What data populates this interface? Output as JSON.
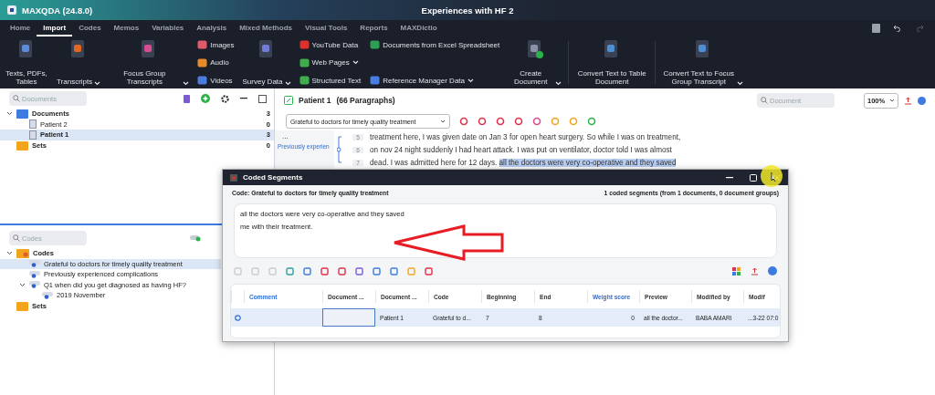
{
  "window": {
    "app_title": "MAXQDA (24.8.0)",
    "project_title": "Experiences with HF 2"
  },
  "tabs": [
    {
      "label": "Home",
      "selected": false
    },
    {
      "label": "Import",
      "selected": true
    },
    {
      "label": "Codes",
      "selected": false
    },
    {
      "label": "Memos",
      "selected": false
    },
    {
      "label": "Variables",
      "selected": false
    },
    {
      "label": "Analysis",
      "selected": false
    },
    {
      "label": "Mixed Methods",
      "selected": false
    },
    {
      "label": "Visual Tools",
      "selected": false
    },
    {
      "label": "Reports",
      "selected": false
    },
    {
      "label": "MAXDictio",
      "selected": false
    }
  ],
  "ribbon": [
    {
      "kind": "large",
      "label": "Texts, PDFs, Tables",
      "dropdown": false
    },
    {
      "kind": "large",
      "label": "Transcripts",
      "dropdown": true
    },
    {
      "kind": "large",
      "label": "Focus Group Transcripts",
      "dropdown": true
    },
    {
      "kind": "small",
      "items": [
        {
          "label": "Images",
          "dropdown": false
        },
        {
          "label": "Audio",
          "dropdown": false
        },
        {
          "label": "Videos",
          "dropdown": false
        }
      ]
    },
    {
      "kind": "large",
      "label": "Survey Data",
      "dropdown": true
    },
    {
      "kind": "small",
      "items": [
        {
          "label": "YouTube Data",
          "dropdown": false
        },
        {
          "label": "Web Pages",
          "dropdown": true
        },
        {
          "label": "Structured Text",
          "dropdown": false
        }
      ]
    },
    {
      "kind": "small",
      "items": [
        {
          "label": "Documents from Excel Spreadsheet",
          "dropdown": false
        },
        {
          "label": "Reference Manager Data",
          "dropdown": true
        }
      ]
    },
    {
      "kind": "large",
      "label": "Create Document",
      "dropdown": true
    },
    {
      "kind": "large",
      "label": "Convert Text to Table Document",
      "dropdown": false
    },
    {
      "kind": "large",
      "label": "Convert Text to Focus Group Transcript",
      "dropdown": true
    }
  ],
  "documents_panel": {
    "search": {
      "placeholder": "Documents"
    },
    "tree": [
      {
        "kind": "folder",
        "label": "Documents",
        "count": "3",
        "expanded": true,
        "selected": false,
        "children": [
          {
            "kind": "document",
            "label": "Patient 2",
            "count": "0",
            "selected": false
          },
          {
            "kind": "document",
            "label": "Patient 1",
            "count": "3",
            "selected": true
          }
        ]
      },
      {
        "kind": "sets",
        "label": "Sets",
        "count": "0",
        "selected": false
      }
    ]
  },
  "codes_panel": {
    "search": {
      "placeholder": "Codes"
    },
    "tree": [
      {
        "kind": "codes",
        "label": "Codes",
        "expanded": true,
        "selected": false,
        "children": [
          {
            "kind": "code",
            "label": "Grateful to doctors for timely quality treatment",
            "selected": true
          },
          {
            "kind": "code",
            "label": "Previously experienced complications",
            "selected": false
          },
          {
            "kind": "code",
            "label": "Q1 when did you get diagnosed as having HF?",
            "expanded": true,
            "selected": false,
            "children": [
              {
                "kind": "code",
                "label": "2019 November",
                "selected": false
              }
            ]
          }
        ]
      },
      {
        "kind": "sets",
        "label": "Sets",
        "selected": false
      }
    ]
  },
  "document_browser": {
    "title": "Patient 1",
    "paragraphs": "(66 Paragraphs)",
    "search": {
      "placeholder": "Document"
    },
    "zoom": "100%",
    "code_select": "Grateful to doctors for timely quality treatment",
    "margin_more": "...",
    "coding_stripe": "Previously experien",
    "lines": [
      {
        "number": "5",
        "text": "treatment here, I was given date on Jan 3 for open heart surgery. So while I was on treatment,"
      },
      {
        "number": "6",
        "text": "on nov 24 night suddenly I had heart attack. I was put on ventilator, doctor told I was almost"
      },
      {
        "number": "7",
        "text": "dead. I was admitted here for 12 days.",
        "highlight": "all the doctors were very co-operative and they saved"
      }
    ]
  },
  "coded_segments": {
    "title": "Coded Segments",
    "code": "Code: Grateful to doctors for timely quality treatment",
    "summary": "1 coded segments (from 1 documents, 0 document groups)",
    "preview_lines": [
      "all the doctors were very co-operative and they saved",
      "me with their treatment."
    ],
    "columns": [
      {
        "label": "Comment",
        "highlight": true
      },
      {
        "label": "Document ...",
        "highlight": false
      },
      {
        "label": "Document ...",
        "highlight": false
      },
      {
        "label": "Code",
        "highlight": false
      },
      {
        "label": "Beginning",
        "highlight": false
      },
      {
        "label": "End",
        "highlight": false
      },
      {
        "label": "Weight score",
        "highlight": true
      },
      {
        "label": "Preview",
        "highlight": false
      },
      {
        "label": "Modified by",
        "highlight": false
      },
      {
        "label": "Modif",
        "highlight": false
      }
    ],
    "rows": [
      {
        "selected": true,
        "cells": [
          {},
          {
            "focused": true
          },
          {
            "text": "Patient 1"
          },
          {
            "text": "Grateful to d..."
          },
          {
            "text": "7"
          },
          {
            "text": "8"
          },
          {
            "text": "0"
          },
          {
            "text": "all the doctor..."
          },
          {
            "text": "BABA  AMARI"
          },
          {
            "text": "...3-22 07:0"
          }
        ]
      }
    ]
  }
}
